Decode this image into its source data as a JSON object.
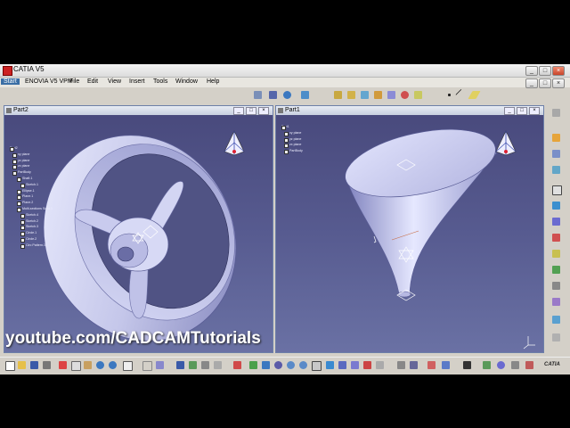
{
  "window": {
    "title": "CATIA V5"
  },
  "menu": [
    "Start",
    "ENOVIA V5 VPM",
    "File",
    "Edit",
    "View",
    "Insert",
    "Tools",
    "Window",
    "Help"
  ],
  "part2": {
    "title": "Part2",
    "tree": [
      "Part2",
      "xy plane",
      "yz plane",
      "zx plane",
      "PartBody",
      "Shaft.1",
      "Sketch.1",
      "Ellipse.1",
      "Plane.1",
      "Plane.2",
      "Multi-sections Solid.1",
      "Sketch.4",
      "Sketch.2",
      "Sketch.3",
      "Circle.1",
      "Circle.2",
      "Circ Pattern.1"
    ]
  },
  "part1": {
    "title": "Part1",
    "tree": [
      "Part1",
      "xy plane",
      "yz plane",
      "zx plane",
      "PartBody"
    ]
  },
  "watermark": "youtube.com/CADCAMTutorials",
  "logo": "CATIA",
  "icons": [
    "compass-icon",
    "axis-icon",
    "save-icon",
    "open-icon",
    "new-icon",
    "print-icon",
    "undo-icon",
    "redo-icon",
    "zoom-icon",
    "rotate-icon",
    "pan-icon"
  ],
  "colors": {
    "viewport_top": "#494a7d",
    "viewport_bottom": "#6a71a4",
    "part": "#c7c9ea",
    "menu_active": "#3a6ea5"
  }
}
